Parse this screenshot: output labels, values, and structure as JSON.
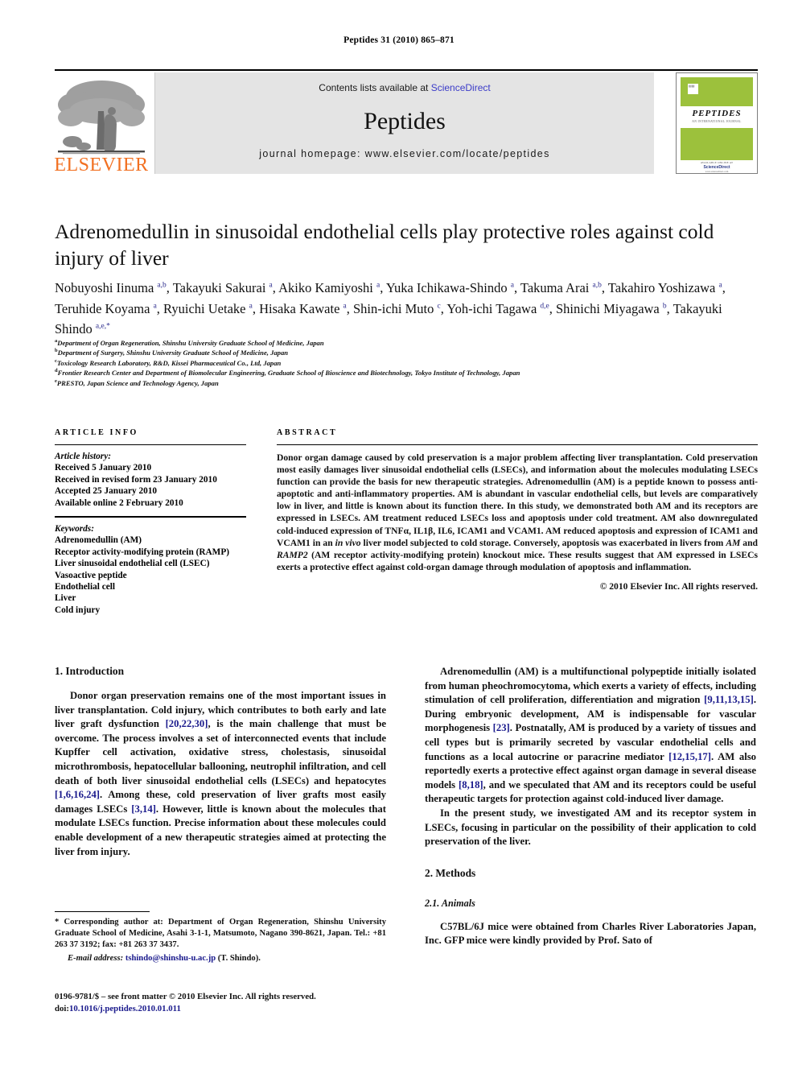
{
  "running_head": "Peptides 31 (2010) 865–871",
  "journal_header": {
    "contents_prefix": "Contents lists available at ",
    "sciencedirect": "ScienceDirect",
    "journal_title": "Peptides",
    "homepage": "journal homepage: www.elsevier.com/locate/peptides",
    "publisher_logo_text": "ELSEVIER",
    "cover": {
      "name": "PEPTIDES",
      "subtitle": "AN INTERNATIONAL JOURNAL",
      "footer_note": "AVAILABLE ONLINE AT",
      "platform": "ScienceDirect",
      "url": "www.sciencedirect.com"
    },
    "colors": {
      "banner_bg": "#e4e4e4",
      "link": "#3b3bc8",
      "elsevier_orange": "#f27021",
      "cover_green": "#9cc13c"
    }
  },
  "article": {
    "title": "Adrenomedullin in sinusoidal endothelial cells play protective roles against cold injury of liver",
    "authors_html": "Nobuyoshi Iinuma <sup>a,b</sup>, Takayuki Sakurai <sup>a</sup>, Akiko Kamiyoshi <sup>a</sup>, Yuka Ichikawa-Shindo <sup>a</sup>, Takuma Arai <sup>a,b</sup>, Takahiro Yoshizawa <sup>a</sup>, Teruhide Koyama <sup>a</sup>, Ryuichi Uetake <sup>a</sup>, Hisaka Kawate <sup>a</sup>, Shin-ichi Muto <sup>c</sup>, Yoh-ichi Tagawa <sup>d,e</sup>, Shinichi Miyagawa <sup>b</sup>, Takayuki Shindo <sup>a,e,</sup><sup>*</sup>",
    "affiliations": [
      {
        "marker": "a",
        "text": "Department of Organ Regeneration, Shinshu University Graduate School of Medicine, Japan"
      },
      {
        "marker": "b",
        "text": "Department of Surgery, Shinshu University Graduate School of Medicine, Japan"
      },
      {
        "marker": "c",
        "text": "Toxicology Research Laboratory, R&D, Kissei Pharmaceutical Co., Ltd, Japan"
      },
      {
        "marker": "d",
        "text": "Frontier Research Center and Department of Biomolecular Engineering, Graduate School of Bioscience and Biotechnology, Tokyo Institute of Technology, Japan"
      },
      {
        "marker": "e",
        "text": "PRESTO, Japan Science and Technology Agency, Japan"
      }
    ]
  },
  "article_info": {
    "heading": "ARTICLE INFO",
    "history_label": "Article history:",
    "history": [
      "Received 5 January 2010",
      "Received in revised form 23 January 2010",
      "Accepted 25 January 2010",
      "Available online 2 February 2010"
    ],
    "keywords_label": "Keywords:",
    "keywords": [
      "Adrenomedullin (AM)",
      "Receptor activity-modifying protein (RAMP)",
      "Liver sinusoidal endothelial cell (LSEC)",
      "Vasoactive peptide",
      "Endothelial cell",
      "Liver",
      "Cold injury"
    ]
  },
  "abstract": {
    "heading": "ABSTRACT",
    "body_html": "Donor organ damage caused by cold preservation is a major problem affecting liver transplantation. Cold preservation most easily damages liver sinusoidal endothelial cells (LSECs), and information about the molecules modulating LSECs function can provide the basis for new therapeutic strategies. Adrenomedullin (AM) is a peptide known to possess anti-apoptotic and anti-inflammatory properties. AM is abundant in vascular endothelial cells, but levels are comparatively low in liver, and little is known about its function there. In this study, we demonstrated both AM and its receptors are expressed in LSECs. AM treatment reduced LSECs loss and apoptosis under cold treatment. AM also downregulated cold-induced expression of TNF&alpha;, IL1&beta;, IL6, ICAM1 and VCAM1. AM reduced apoptosis and expression of ICAM1 and VCAM1 in an <i>in vivo</i> liver model subjected to cold storage. Conversely, apoptosis was exacerbated in livers from <i>AM</i> and <i>RAMP2</i> (AM receptor activity-modifying protein) knockout mice. These results suggest that AM expressed in LSECs exerts a protective effect against cold-organ damage through modulation of apoptosis and inflammation.",
    "copyright": "© 2010 Elsevier Inc. All rights reserved."
  },
  "body": {
    "intro_heading": "1. Introduction",
    "intro_p1_html": "Donor organ preservation remains one of the most important issues in liver transplantation. Cold injury, which contributes to both early and late liver graft dysfunction <span class=\"cite\">[20,22,30]</span>, is the main challenge that must be overcome. The process involves a set of interconnected events that include Kupffer cell activation, oxidative stress, cholestasis, sinusoidal microthrombosis, hepatocellular ballooning, neutrophil infiltration, and cell death of both liver sinusoidal endothelial cells (LSECs) and hepatocytes <span class=\"cite\">[1,6,16,24]</span>. Among these, cold preservation of liver grafts most easily damages LSECs <span class=\"cite\">[3,14]</span>. However, little is known about the molecules that modulate LSECs function. Precise information about these molecules could enable development of a new therapeutic strategies aimed at protecting the liver from injury.",
    "intro_p2_html": "Adrenomedullin (AM) is a multifunctional polypeptide initially isolated from human pheochromocytoma, which exerts a variety of effects, including stimulation of cell proliferation, differentiation and migration <span class=\"cite\">[9,11,13,15]</span>. During embryonic development, AM is indispensable for vascular morphogenesis <span class=\"cite\">[23]</span>. Postnatally, AM is produced by a variety of tissues and cell types but is primarily secreted by vascular endothelial cells and functions as a local autocrine or paracrine mediator <span class=\"cite\">[12,15,17]</span>. AM also reportedly exerts a protective effect against organ damage in several disease models <span class=\"cite\">[8,18]</span>, and we speculated that AM and its receptors could be useful therapeutic targets for protection against cold-induced liver damage.",
    "intro_p3_html": "In the present study, we investigated AM and its receptor system in LSECs, focusing in particular on the possibility of their application to cold preservation of the liver.",
    "methods_heading": "2. Methods",
    "methods_sub_heading": "2.1. Animals",
    "methods_p1_html": "C57BL/6J mice were obtained from Charles River Laboratories Japan, Inc. GFP mice were kindly provided by Prof. Sato of"
  },
  "footnote": {
    "corresponding_html": "<b>*</b> Corresponding author at: Department of Organ Regeneration, Shinshu University Graduate School of Medicine, Asahi 3-1-1, Matsumoto, Nagano 390-8621, Japan. Tel.: +81 263 37 3192; fax: +81 263 37 3437.",
    "email_label": "E-mail address:",
    "email": "tshindo@shinshu-u.ac.jp",
    "email_suffix": "(T. Shindo).",
    "issn_line": "0196-9781/$ – see front matter © 2010 Elsevier Inc. All rights reserved.",
    "doi_label": "doi:",
    "doi_value": "10.1016/j.peptides.2010.01.011"
  }
}
